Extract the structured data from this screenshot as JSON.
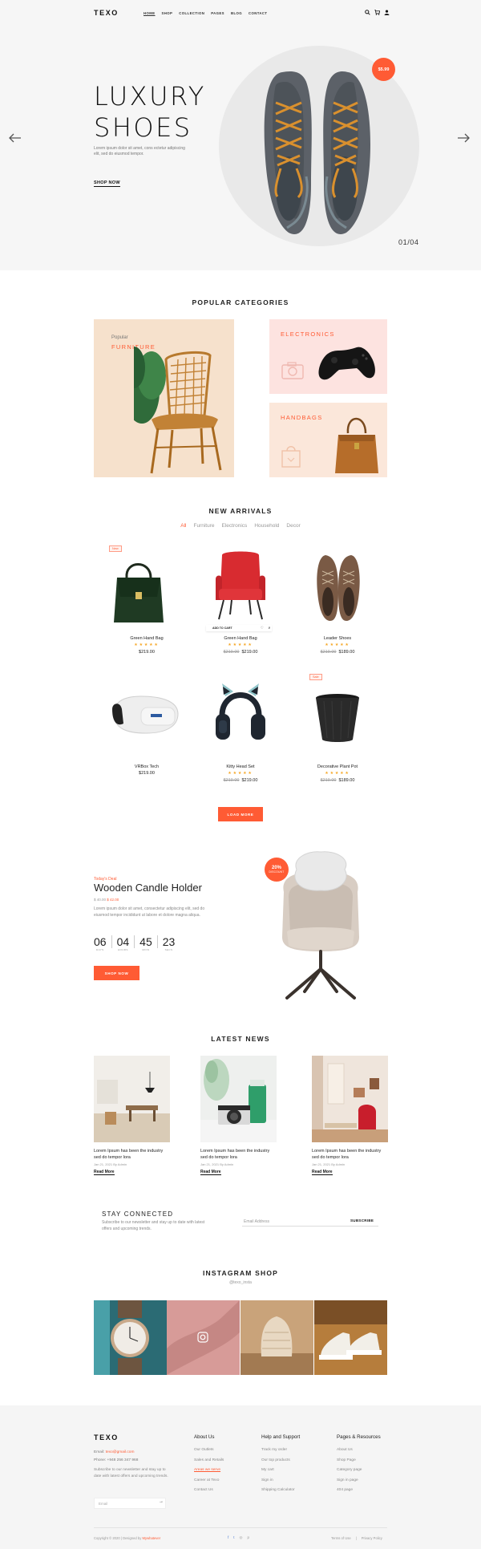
{
  "header": {
    "logo": "TEXO",
    "nav": [
      "HOME",
      "SHOP",
      "COLLECTION",
      "PAGES",
      "BLOG",
      "CONTACT"
    ],
    "icons": [
      "search-icon",
      "cart-icon",
      "user-icon"
    ]
  },
  "hero": {
    "title_line1": "LUXURY",
    "title_line2": "SHOES",
    "desc": "Lorem ipsum dolor sit amet, cons ectetur adipiscing elit, sed do eiusmod tempor.",
    "cta": "SHOP NOW",
    "price_badge": "$5.99",
    "slide_counter": "01/04"
  },
  "categories": {
    "title": "POPULAR CATEGORIES",
    "big": {
      "sub": "Popular",
      "title": "FURNITURE"
    },
    "electronics": "ELECTRONICS",
    "handbags": "HANDBAGS"
  },
  "arrivals": {
    "title": "NEW ARRIVALS",
    "filters": [
      "All",
      "Furniture",
      "Electronics",
      "Household",
      "Decor"
    ],
    "cart_label": "ADD TO CART",
    "load_more": "LOAD MORE",
    "badges": {
      "new": "New",
      "sale": "Sale"
    },
    "products": [
      {
        "name": "Green Hand Bag",
        "old": "",
        "price": "$219.00",
        "stars": "★★★★★"
      },
      {
        "name": "Green Hand Bag",
        "old": "$219.00",
        "price": "$219.00",
        "stars": "★★★★★"
      },
      {
        "name": "Leader Shoes",
        "old": "$219.00",
        "price": "$189.00",
        "stars": "★★★★★"
      },
      {
        "name": "VRBox Tech",
        "old": "",
        "price": "$219.00",
        "stars": ""
      },
      {
        "name": "Kitty Head Set",
        "old": "$219.00",
        "price": "$219.00",
        "stars": "★★★★★"
      },
      {
        "name": "Decorative Plant Pot",
        "old": "$219.00",
        "price": "$189.00",
        "stars": "★★★★★"
      }
    ]
  },
  "deal": {
    "tag": "Today's Deal",
    "title": "Wooden Candle Holder",
    "old_price": "$ 40.00",
    "new_price": "$ 42.00",
    "desc": "Lorem ipsum dolor sit amet, consectetur adipiscing elit, sed do eiusmod tempor incididunt ut labore et dolore magna aliqua.",
    "countdown": [
      {
        "num": "06",
        "label": "DAYS"
      },
      {
        "num": "04",
        "label": "HOURS"
      },
      {
        "num": "45",
        "label": "MINS"
      },
      {
        "num": "23",
        "label": "SECS"
      }
    ],
    "cta": "SHOP NOW",
    "discount_pct": "20%",
    "discount_txt": "DISCOUNT"
  },
  "news": {
    "title": "LATEST NEWS",
    "items": [
      {
        "title": "Lorem Ipsum has been the industry sed do tempor lora",
        "meta": "Jan 21, 2021 By Admin",
        "more": "Read More"
      },
      {
        "title": "Lorem Ipsum has been the industry sed do tempor lora",
        "meta": "Jan 21, 2021 By Admin",
        "more": "Read More"
      },
      {
        "title": "Lorem Ipsum has been the industry sed do tempor lora",
        "meta": "Jan 21, 2021 By Admin",
        "more": "Read More"
      }
    ]
  },
  "newsletter": {
    "title": "STAY CONNECTED",
    "desc": "Subscribe to our newsletter and stay up to date with latest offers and upcoming trends.",
    "placeholder": "Email Address",
    "button": "SUBSCRIBE"
  },
  "instagram": {
    "title": "INSTAGRAM SHOP",
    "handle": "@texo_insta"
  },
  "footer": {
    "logo": "TEXO",
    "email_label": "Email: ",
    "email": "texo@gmail.com",
    "phone_label": "Phone: ",
    "phone": "+948 256 347 968",
    "about": "Subscribe to our newsletter and stay up to date with latest offers and upcoming trends.",
    "email_placeholder": "Email",
    "columns": [
      {
        "title": "About Us",
        "links": [
          "Our Outlets",
          "Sales and Retails",
          "Areas we serve",
          "Career at Texo",
          "Contact Us"
        ]
      },
      {
        "title": "Help and Support",
        "links": [
          "Track my order",
          "Our top products",
          "My cart",
          "Sign in",
          "Shipping Calculator"
        ]
      },
      {
        "title": "Pages & Resources",
        "links": [
          "About Us",
          "Shop Page",
          "Category page",
          "Sign in page",
          "404 page"
        ]
      }
    ],
    "copyright": "Copyright © 2020 | Designed by ",
    "designer": "Mywhatever",
    "terms": "Terms of Use",
    "privacy": "Privacy Policy",
    "social": [
      "facebook-icon",
      "twitter-icon",
      "instagram-icon",
      "pinterest-icon"
    ]
  },
  "colors": {
    "accent": "#ff5b34",
    "hero_bg": "#f6f6f6",
    "footer_bg": "#f5f5f5"
  }
}
